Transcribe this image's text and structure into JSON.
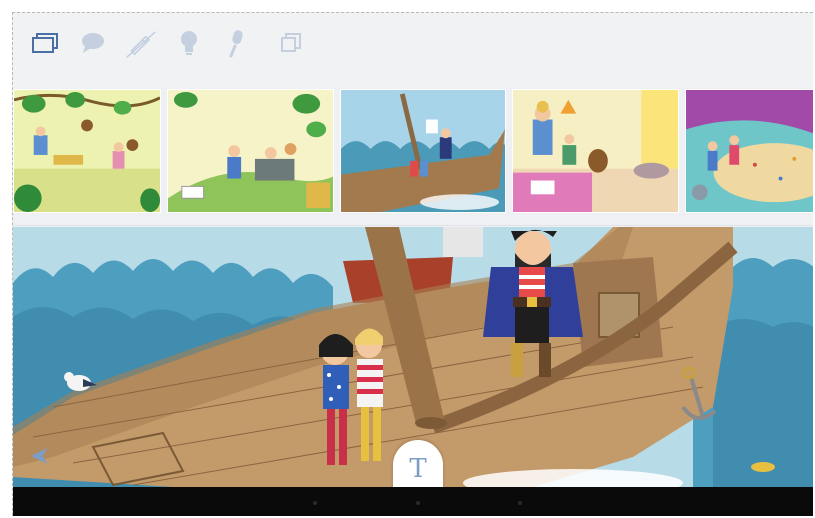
{
  "toolbar": {
    "tools": [
      {
        "icon": "pages-icon"
      },
      {
        "icon": "speech-bubble-icon"
      },
      {
        "icon": "pen-disabled-icon"
      },
      {
        "icon": "lightbulb-icon"
      },
      {
        "icon": "microphone-icon"
      },
      {
        "icon": "copy-icon"
      }
    ],
    "icon_color_active": "#4a6fa5",
    "icon_color_inactive": "#c4d0e0"
  },
  "thumbnails": [
    {
      "scene": "jungle-monkeys"
    },
    {
      "scene": "picnic-family"
    },
    {
      "scene": "pirate-ship-small"
    },
    {
      "scene": "kids-room"
    },
    {
      "scene": "playground-purple"
    }
  ],
  "main_page": {
    "scene": "pirate-ship-deck"
  },
  "controls": {
    "text_toggle_label": "T",
    "prev_icon": "triangle-left-icon",
    "accent": "#7e9cc4"
  }
}
